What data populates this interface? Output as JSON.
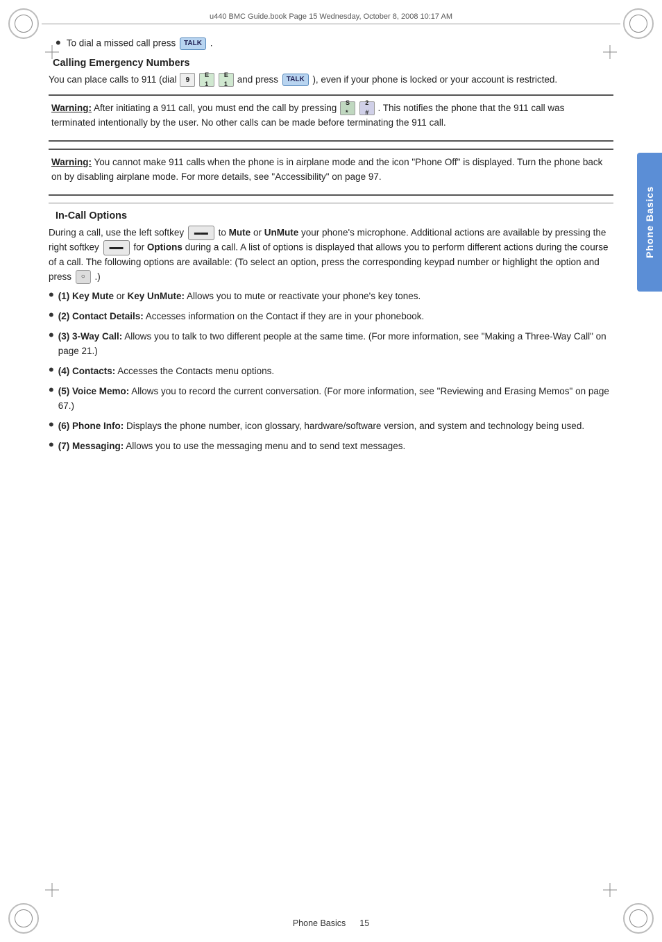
{
  "page": {
    "header_text": "u440 BMC Guide.book  Page 15  Wednesday, October 8, 2008  10:17 AM",
    "side_tab_label": "Phone Basics",
    "footer_left": "Phone Basics",
    "footer_right": "15",
    "content": {
      "bullet_missed_call": "To dial a missed call press",
      "section_calling_emergency": "Calling Emergency Numbers",
      "emergency_text": "You can place calls to 911 (dial",
      "emergency_text2": "and press",
      "emergency_text3": "), even if your phone is locked or your account is restricted.",
      "warning1_label": "Warning:",
      "warning1_text": " After initiating a 911 call, you must end the call by pressing",
      "warning1_text2": ". This notifies the phone that the 911 call was terminated intentionally by the user. No other calls can be made before terminating the 911 call.",
      "warning2_label": "Warning:",
      "warning2_text": " You cannot make 911 calls when the phone is in airplane mode and the icon \"Phone Off\" is displayed. Turn the phone back on by disabling airplane mode. For more details, see \"Accessibility\" on page 97.",
      "section_incall": "In-Call Options",
      "incall_intro": "During a call, use the left softkey",
      "incall_intro2": "to",
      "incall_mute": "Mute",
      "incall_or": "or",
      "incall_unmute": "UnMute",
      "incall_text2": "your phone's microphone. Additional actions are available by pressing the right softkey",
      "incall_text3": "for",
      "incall_options": "Options",
      "incall_text4": "during a call. A list of options is displayed that allows you to perform different actions during the course of a call. The following options are available: (To select an option, press the corresponding keypad number or highlight the option and press",
      "incall_text5": ".)",
      "list_items": [
        {
          "key": "(1) Key Mute",
          "or": "or",
          "key2": "Key UnMute:",
          "text": " Allows you to mute or reactivate your phone's key tones."
        },
        {
          "key": "(2) Contact Details:",
          "text": " Accesses information on the Contact if they are in your phonebook."
        },
        {
          "key": "(3) 3-Way Call:",
          "text": " Allows you to talk to two different people at the same time. (For more information, see \"Making a Three-Way Call\" on page 21.)"
        },
        {
          "key": "(4) Contacts:",
          "text": " Accesses the Contacts menu options."
        },
        {
          "key": "(5) Voice Memo:",
          "text": " Allows you to record the current conversation. (For more information, see \"Reviewing and Erasing Memos\" on page 67.)"
        },
        {
          "key": "(6) Phone Info:",
          "text": " Displays the phone number, icon glossary, hardware/software version, and system and technology being used."
        },
        {
          "key": "(7) Messaging:",
          "text": " Allows you to use the messaging menu and to send text messages."
        }
      ]
    }
  }
}
